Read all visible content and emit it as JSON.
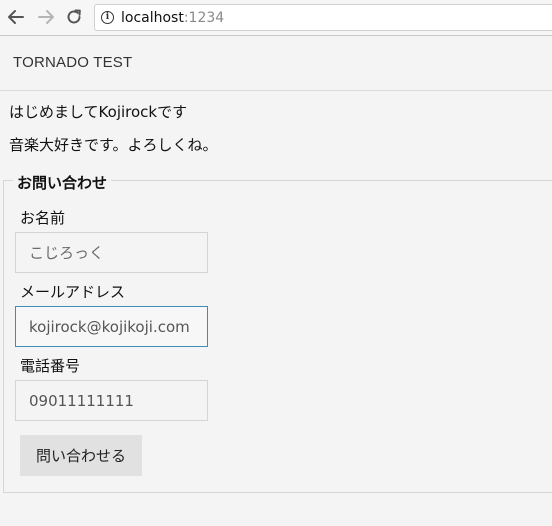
{
  "browser": {
    "url_host": "localhost",
    "url_port": ":1234"
  },
  "site": {
    "title": "TORNADO TEST"
  },
  "intro": {
    "line1": "はじめましてKojirockです",
    "line2": "音楽大好きです。よろしくね。"
  },
  "contact_form": {
    "legend": "お問い合わせ",
    "name_label": "お名前",
    "name_placeholder": "こじろっく",
    "email_label": "メールアドレス",
    "email_value": "kojirock@kojikoji.com",
    "phone_label": "電話番号",
    "phone_value": "09011111111",
    "submit_label": "問い合わせる"
  },
  "colors": {
    "focus_border": "#3b8fb3",
    "button_bg": "#e1e1e1",
    "page_bg": "#f4f4f4"
  }
}
